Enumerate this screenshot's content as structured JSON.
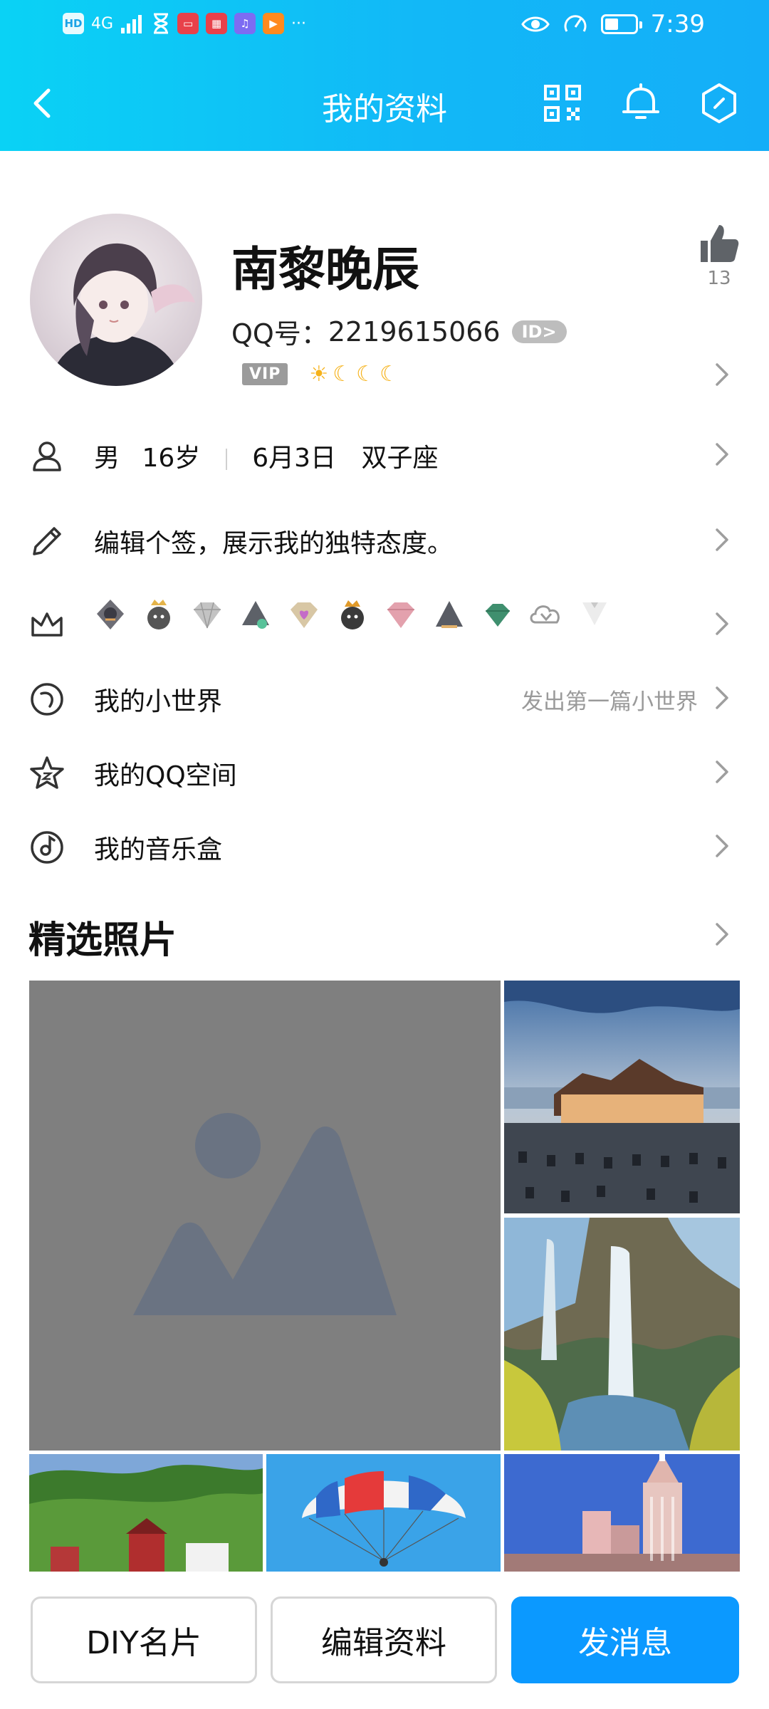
{
  "status_bar": {
    "left_icons": [
      "HD",
      "4G",
      "signal-icon",
      "hourglass-icon",
      "reader-app-icon",
      "huawei-app-icon",
      "music-app-icon",
      "video-app-icon",
      "more-dots-icon"
    ],
    "hd": "HD",
    "net": "4G",
    "time": "7:39"
  },
  "nav": {
    "title": "我的资料",
    "icons": [
      "back-arrow-icon",
      "qr-code-icon",
      "bell-icon",
      "hexagon-settings-icon"
    ]
  },
  "profile": {
    "name": "南黎晚辰",
    "qq_label": "QQ号：",
    "qq_number": "2219615066",
    "id_badge": "ID>",
    "vip_label": "VIP",
    "level_icons": [
      "sun-icon",
      "moon-icon",
      "moon-icon",
      "moon-icon"
    ],
    "like_count": "13"
  },
  "info": {
    "gender": "男",
    "age": "16岁",
    "birthday": "6月3日",
    "zodiac": "双子座"
  },
  "signature": "编辑个签，展示我的独特态度。",
  "badges": [
    "penguin-badge",
    "penguin-crown-badge",
    "diamond-badge",
    "penguin-gem-badge",
    "heart-diamond-badge",
    "penguin-king-badge",
    "pink-diamond-badge",
    "penguin-hat-badge",
    "green-gem-badge",
    "cloud-v-badge",
    "tuxedo-badge"
  ],
  "menu": [
    {
      "label": "我的小世界",
      "hint": "发出第一篇小世界",
      "icon": "world-icon"
    },
    {
      "label": "我的QQ空间",
      "icon": "star-icon"
    },
    {
      "label": "我的音乐盒",
      "icon": "music-disc-icon"
    }
  ],
  "photos": {
    "title": "精选照片",
    "items": [
      "placeholder-image",
      "pier-house-photo",
      "waterfall-photo",
      "green-valley-house-photo",
      "parachute-photo",
      "city-tower-photo"
    ]
  },
  "buttons": {
    "diy": "DIY名片",
    "edit": "编辑资料",
    "message": "发消息"
  },
  "colors": {
    "header_start": "#0ad2f5",
    "header_end": "#14aef8",
    "primary_button": "#0b99ff"
  }
}
